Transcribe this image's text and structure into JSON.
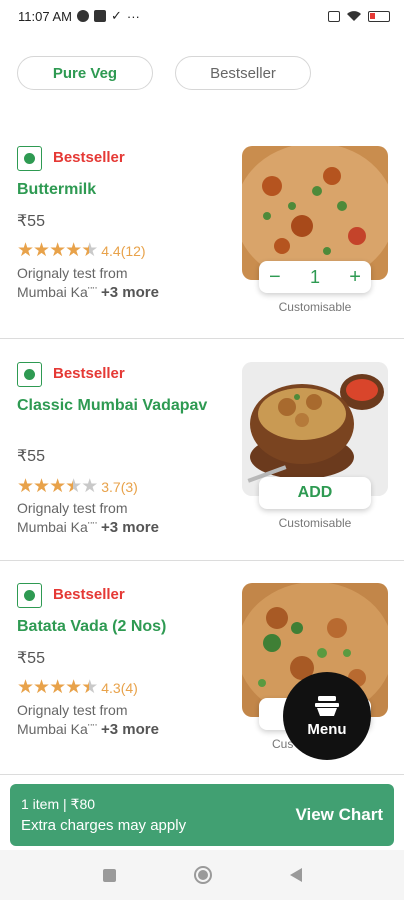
{
  "status_bar": {
    "time": "11:07 AM",
    "icons": [
      "skype-icon",
      "grid-app-icon",
      "check-icon",
      "more-icon",
      "sim-icon",
      "wifi-icon",
      "battery-icon"
    ]
  },
  "filters": [
    {
      "label": "Pure Veg",
      "active": true
    },
    {
      "label": "Bestseller",
      "active": false
    }
  ],
  "items": [
    {
      "badge": "Bestseller",
      "name": "Buttermilk",
      "price": "₹55",
      "rating": 4.4,
      "rating_text": "4.4(12)",
      "desc_line1": "Orignaly test from",
      "desc_line2": "Mumbai Ka¨¨",
      "more": "+3 more",
      "control": "stepper",
      "quantity": "1",
      "minus": "−",
      "plus": "+",
      "customisable": "Customisable"
    },
    {
      "badge": "Bestseller",
      "name": "Classic Mumbai Vadapav",
      "price": "₹55",
      "rating": 3.7,
      "rating_text": "3.7(3)",
      "desc_line1": "Orignaly test from",
      "desc_line2": "Mumbai Ka¨¨",
      "more": "+3 more",
      "control": "add",
      "add_label": "ADD",
      "customisable": "Customisable"
    },
    {
      "badge": "Bestseller",
      "name": "Batata Vada (2 Nos)",
      "price": "₹55",
      "rating": 4.3,
      "rating_text": "4.3(4)",
      "desc_line1": "Orignaly test from",
      "desc_line2": "Mumbai Ka¨¨",
      "more": "+3 more",
      "control": "add",
      "customisable": "Cus"
    }
  ],
  "menu_fab": {
    "label": "Menu",
    "icon": "menu-bowl-icon"
  },
  "cart": {
    "summary": "1 item | ₹80",
    "note": "Extra charges may apply",
    "action": "View Chart"
  },
  "colors": {
    "veg_green": "#2e9a52",
    "bestseller_red": "#e53935",
    "star_orange": "#e8a24a",
    "cart_green": "#41a072"
  }
}
